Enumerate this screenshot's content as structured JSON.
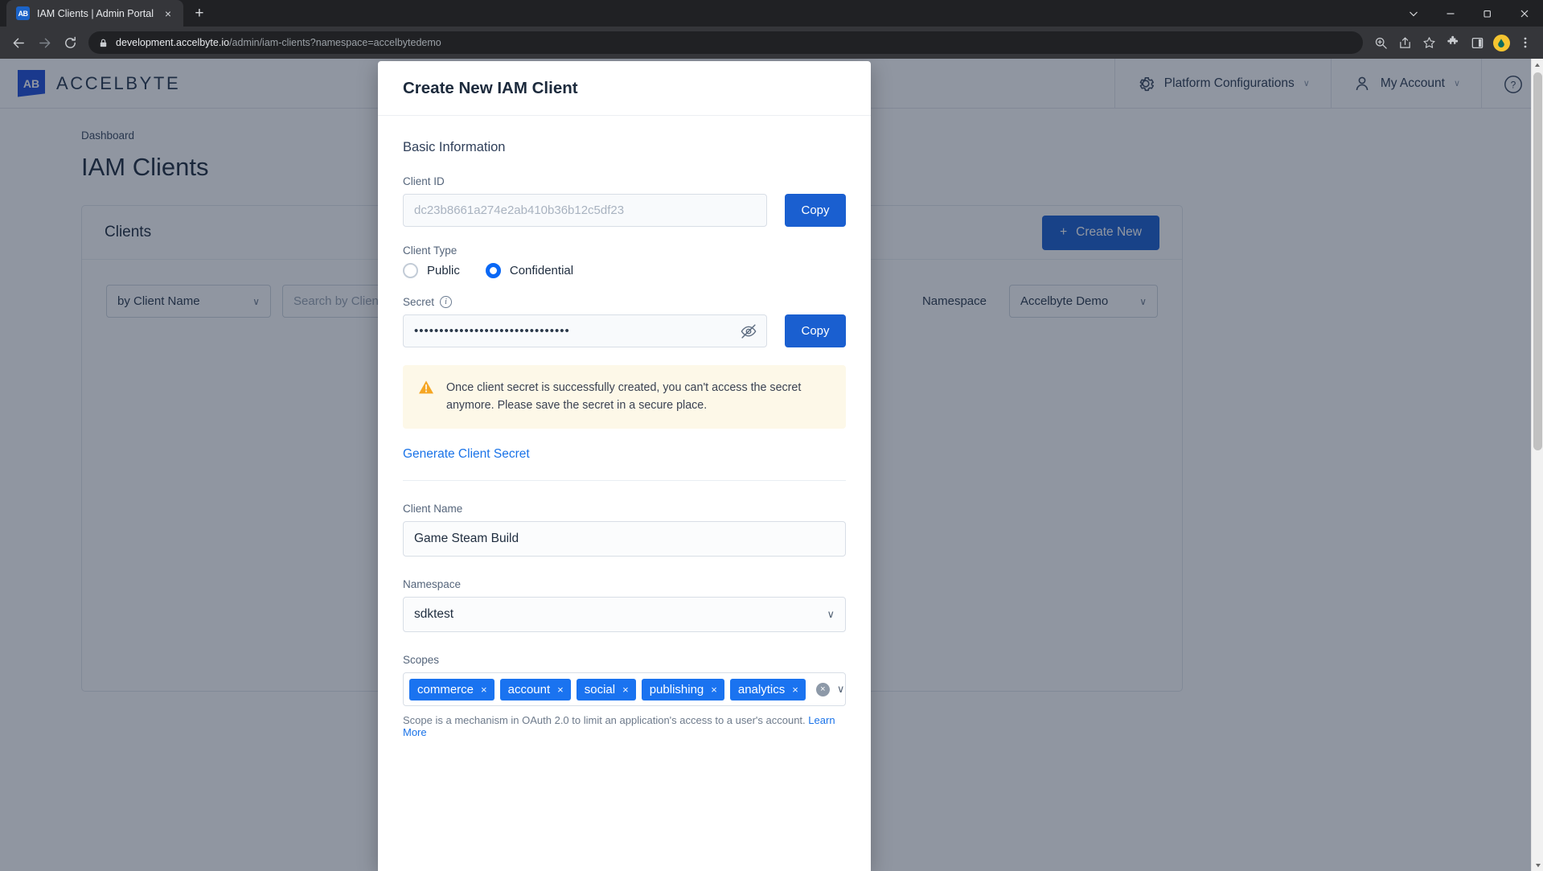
{
  "browser": {
    "tab": {
      "title": "IAM Clients | Admin Portal",
      "favicon_label": "AB",
      "close_label": "×"
    },
    "new_tab_label": "+",
    "url_bold": "development.accelbyte.io",
    "url_rest": "/admin/iam-clients?namespace=accelbytedemo",
    "window_controls": {
      "expand": "∨",
      "minimize": "—",
      "maximize": "❐",
      "close": "✕"
    }
  },
  "app_header": {
    "brand_mark": "AB",
    "brand_text": "ACCELBYTE",
    "platform_config": "Platform Configurations",
    "my_account": "My Account",
    "caret": "∨",
    "help": "?"
  },
  "page": {
    "breadcrumb": "Dashboard",
    "title": "IAM Clients",
    "card_title": "Clients",
    "create_new": "Create New",
    "create_new_plus": "+",
    "filter_by_client_name": "by Client Name",
    "search_placeholder": "Search by Client Name",
    "filter_third": "",
    "namespace_label": "Namespace",
    "namespace_value": "Accelbyte Demo",
    "chevron": "∨"
  },
  "modal": {
    "title": "Create New IAM Client",
    "section_basic": "Basic Information",
    "client_id_label": "Client ID",
    "client_id_value": "dc23b8661a274e2ab410b36b12c5df23",
    "copy_label": "Copy",
    "client_type_label": "Client Type",
    "client_type_options": [
      {
        "label": "Public",
        "selected": false
      },
      {
        "label": "Confidential",
        "selected": true
      }
    ],
    "secret_label": "Secret",
    "secret_value": "•••••••••••••••••••••••••••••••",
    "secret_copy_label": "Copy",
    "warning_text": "Once client secret is successfully created, you can't access the secret anymore. Please save the secret in a secure place.",
    "generate_secret": "Generate Client Secret",
    "client_name_label": "Client Name",
    "client_name_value": "Game Steam Build",
    "namespace_label": "Namespace",
    "namespace_value": "sdktest",
    "scopes_label": "Scopes",
    "scopes": [
      "commerce",
      "account",
      "social",
      "publishing",
      "analytics"
    ],
    "tag_remove": "×",
    "clear_all": "×",
    "dropdown_chevron": "∨",
    "scopes_helper_text": "Scope is a mechanism in OAuth 2.0 to limit an application's access to a user's account.",
    "scopes_helper_link": "Learn More"
  },
  "colors": {
    "accent_blue": "#1a5fd0",
    "tag_blue": "#1a73f0",
    "link_blue": "#1a73e8",
    "warning_bg": "#fdf8e8",
    "warning_icon": "#f5a623",
    "overlay": "rgba(22,36,59,0.48)"
  }
}
